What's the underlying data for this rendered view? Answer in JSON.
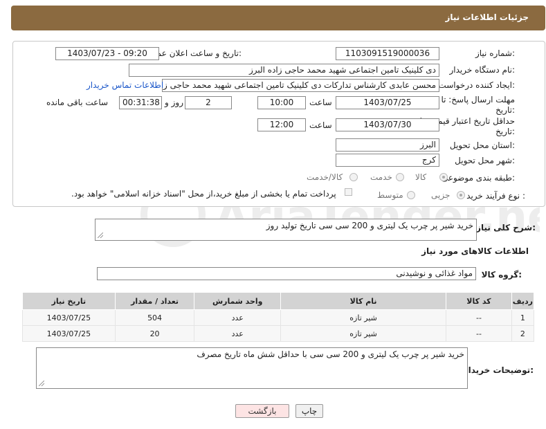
{
  "header": {
    "title": "جزئیات اطلاعات نیاز"
  },
  "form": {
    "need_number_label": "شماره نیاز:",
    "need_number": "1103091519000036",
    "announce_label": "تاریخ و ساعت اعلان عمومی:",
    "announce_value": "1403/07/23 - 09:20",
    "buyer_org_label": "نام دستگاه خریدار:",
    "buyer_org": "دی کلینیک تامین اجتماعی شهید محمد حاجی زاده البرز",
    "requester_label": "ایجاد کننده درخواست:",
    "requester": "محسن عابدی کارشناس تدارکات دی کلینیک تامین اجتماعی شهید محمد حاجی زاده البرز",
    "contact_link": "اطلاعات تماس خریدار",
    "deadline_label_1": "مهلت ارسال پاسخ: تا",
    "deadline_label_2": "تاریخ:",
    "deadline_date": "1403/07/25",
    "time_label": "ساعت",
    "deadline_time": "10:00",
    "days_value": "2",
    "days_label": "روز و",
    "remaining_value": "00:31:38",
    "remaining_label": "ساعت باقی مانده",
    "validity_label_1": "حداقل تاریخ اعتبار قیمت: تا",
    "validity_label_2": "تاریخ:",
    "validity_date": "1403/07/30",
    "validity_time_label": "ساعت",
    "validity_time": "12:00",
    "province_label": "استان محل تحویل:",
    "province": "البرز",
    "city_label": "شهر محل تحویل:",
    "city": "کرج",
    "category_label": "طبقه بندی موضوعی:",
    "category_options": [
      "کالا",
      "خدمت",
      "کالا/خدمت"
    ],
    "process_label": "نوع فرآیند خرید :",
    "process_options": [
      "جزیی",
      "متوسط"
    ],
    "payment_note": "پرداخت تمام یا بخشی از مبلغ خرید،از محل \"اسناد خزانه اسلامی\" خواهد بود."
  },
  "summary": {
    "label": "شرح کلی نیاز:",
    "text": "خرید شیر پر چرب یک لیتری و 200 سی سی تاریخ تولید روز"
  },
  "goods": {
    "section_title": "اطلاعات کالاهای مورد نیاز",
    "group_label": "گروه کالا:",
    "group_value": "مواد غذائی و نوشیدنی",
    "columns": [
      "ردیف",
      "کد کالا",
      "نام کالا",
      "واحد شمارش",
      "تعداد / مقدار",
      "تاریخ نیاز"
    ],
    "rows": [
      {
        "row": "1",
        "code": "--",
        "name": "شیر تازه",
        "unit": "عدد",
        "qty": "504",
        "date": "1403/07/25"
      },
      {
        "row": "2",
        "code": "--",
        "name": "شیر تازه",
        "unit": "عدد",
        "qty": "20",
        "date": "1403/07/25"
      }
    ]
  },
  "buyer_notes": {
    "label": "توضیحات خریدار:",
    "text": "خرید شیر پر چرب یک لیتری و 200 سی سی با حداقل شش ماه تاریخ مصرف"
  },
  "buttons": {
    "print": "چاپ",
    "back": "بازگشت"
  },
  "watermark": {
    "text": "AriaTender.net"
  },
  "colors": {
    "header": "#8b6a40",
    "back_button": "#fde4e4",
    "print_button": "#f0f0f0",
    "link": "#1a56c9"
  }
}
